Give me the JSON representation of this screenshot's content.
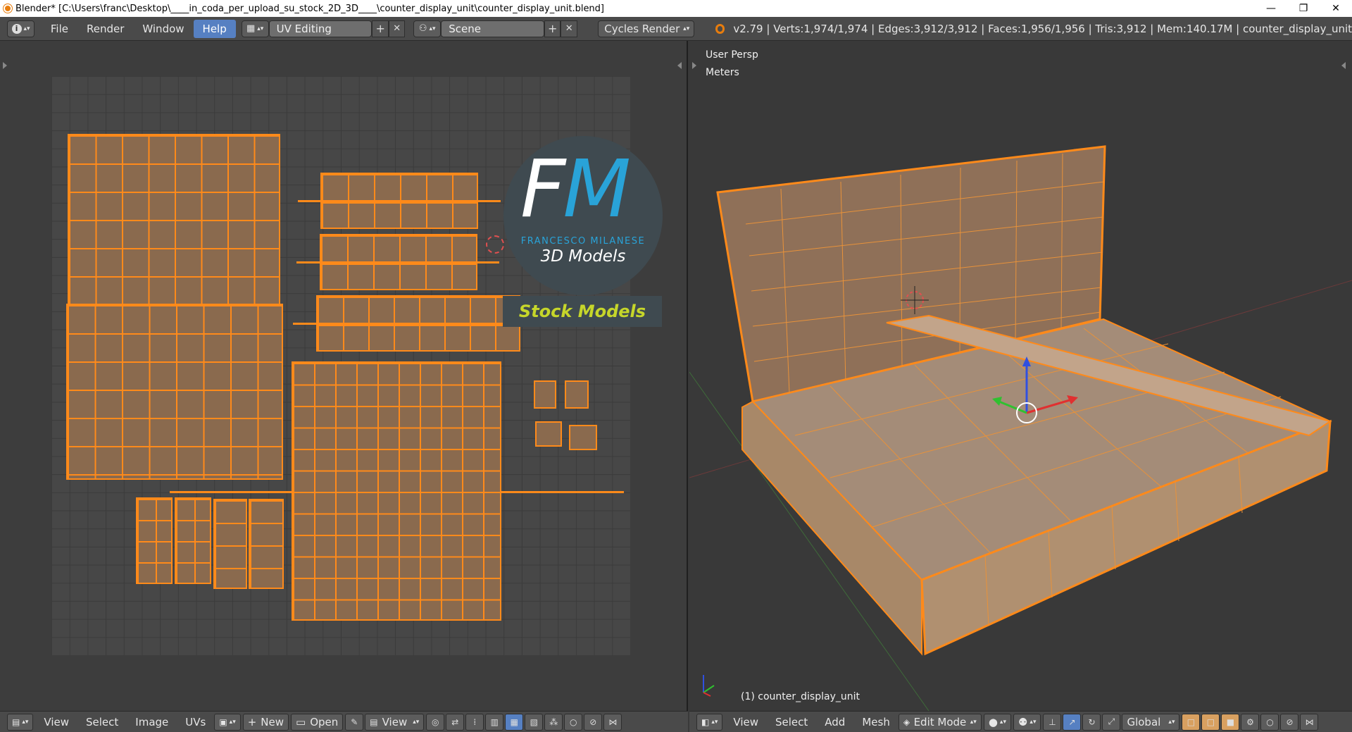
{
  "window": {
    "title": "Blender* [C:\\Users\\franc\\Desktop\\____in_coda_per_upload_su_stock_2D_3D____\\counter_display_unit\\counter_display_unit.blend]",
    "minimize": "—",
    "restore": "❐",
    "close": "✕"
  },
  "info_header": {
    "menus": [
      "File",
      "Render",
      "Window",
      "Help"
    ],
    "active_menu": "Help",
    "screen_layout": "UV Editing",
    "scene": "Scene",
    "render_engine": "Cycles Render",
    "stats": "v2.79 | Verts:1,974/1,974 | Edges:3,912/3,912 | Faces:1,956/1,956 | Tris:3,912 | Mem:140.17M | counter_display_unit"
  },
  "uv_editor": {
    "logo": {
      "letter1": "F",
      "letter2": "M",
      "name": "FRANCESCO MILANESE",
      "subtitle": "3D Models",
      "badge": "Stock Models"
    },
    "header": {
      "menus": [
        "View",
        "Select",
        "Image",
        "UVs"
      ],
      "new_label": "New",
      "open_label": "Open",
      "view_label": "View"
    }
  },
  "view3d": {
    "view_name": "User Persp",
    "units": "Meters",
    "object_label": "(1) counter_display_unit",
    "header": {
      "menus": [
        "View",
        "Select",
        "Add",
        "Mesh"
      ],
      "mode": "Edit Mode",
      "orientation": "Global"
    }
  },
  "colors": {
    "selection": "#ff8a1a",
    "face": "#8a6a4e",
    "active_blue": "#5680c2",
    "logo_blue": "#29a3d8",
    "logo_green": "#c6d62a"
  }
}
